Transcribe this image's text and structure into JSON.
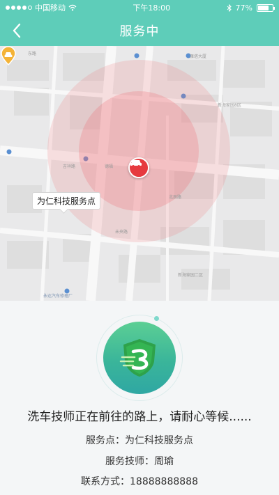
{
  "status_bar": {
    "carrier": "中国移动",
    "time": "下午18:00",
    "battery": "77%",
    "battery_level": 0.77
  },
  "nav": {
    "title": "服务中"
  },
  "map": {
    "service_point_label": "为仁科技服务点",
    "labels": [
      "新海家园8区",
      "东路",
      "雁塔大厦",
      "德福",
      "新海家园二区",
      "永达汽车修理厂",
      "吉祥路",
      "未央路",
      "北辰路"
    ]
  },
  "panel": {
    "message": "洗车技师正在前往的路上，请耐心等候......",
    "service_point_label": "服务点：",
    "service_point_value": "为仁科技服务点",
    "technician_label": "服务技师：",
    "technician_value": "周瑜",
    "contact_label": "联系方式：",
    "contact_value": "18888888888"
  }
}
